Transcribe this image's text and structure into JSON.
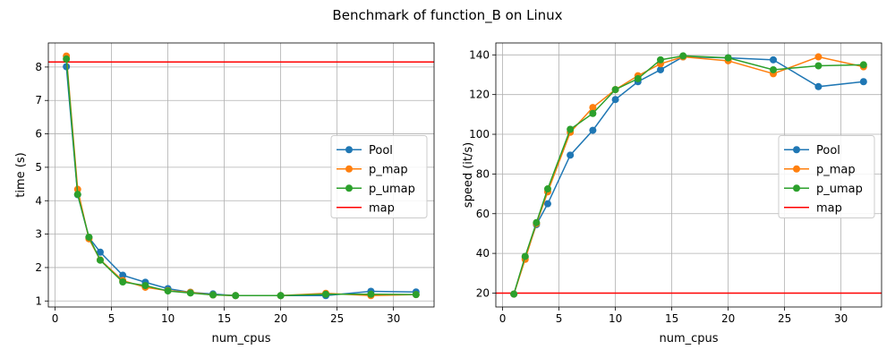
{
  "figure": {
    "title": "Benchmark of function_B on Linux"
  },
  "chart_data": [
    {
      "type": "line",
      "xlabel": "num_cpus",
      "ylabel": "time (s)",
      "xlim": [
        -0.6,
        33.6
      ],
      "ylim": [
        0.82,
        8.72
      ],
      "xticks": [
        0,
        5,
        10,
        15,
        20,
        25,
        30
      ],
      "yticks": [
        1,
        2,
        3,
        4,
        5,
        6,
        7,
        8
      ],
      "grid": true,
      "legend_placement": "center-right",
      "x": [
        1,
        2,
        3,
        4,
        6,
        8,
        10,
        12,
        14,
        16,
        20,
        24,
        28,
        32
      ],
      "series": [
        {
          "name": "Pool",
          "color": "#1f77b4",
          "marker": "circle",
          "values": [
            8.01,
            4.18,
            2.9,
            2.46,
            1.77,
            1.56,
            1.37,
            1.26,
            1.21,
            1.16,
            1.16,
            1.16,
            1.29,
            1.27
          ]
        },
        {
          "name": "p_map",
          "color": "#ff7f0e",
          "marker": "circle",
          "values": [
            8.33,
            4.34,
            2.86,
            2.23,
            1.61,
            1.41,
            1.31,
            1.26,
            1.18,
            1.16,
            1.16,
            1.23,
            1.16,
            1.19
          ]
        },
        {
          "name": "p_umap",
          "color": "#2ca02c",
          "marker": "circle",
          "values": [
            8.24,
            4.19,
            2.91,
            2.22,
            1.57,
            1.46,
            1.3,
            1.24,
            1.18,
            1.16,
            1.16,
            1.2,
            1.2,
            1.19
          ]
        }
      ],
      "hline": {
        "name": "map",
        "color": "#ff0000",
        "value": 8.15
      }
    },
    {
      "type": "line",
      "xlabel": "num_cpus",
      "ylabel": "speed (it/s)",
      "xlim": [
        -0.6,
        33.6
      ],
      "ylim": [
        13.0,
        146.0
      ],
      "xticks": [
        0,
        5,
        10,
        15,
        20,
        25,
        30
      ],
      "yticks": [
        20,
        40,
        60,
        80,
        100,
        120,
        140
      ],
      "grid": true,
      "legend_placement": "center-right",
      "x": [
        1,
        2,
        3,
        4,
        6,
        8,
        10,
        12,
        14,
        16,
        20,
        24,
        28,
        32
      ],
      "series": [
        {
          "name": "Pool",
          "color": "#1f77b4",
          "marker": "circle",
          "values": [
            19.5,
            38,
            54.5,
            65,
            89.5,
            102,
            117.5,
            126.5,
            132.5,
            139,
            138.5,
            137.5,
            124,
            126.5
          ]
        },
        {
          "name": "p_map",
          "color": "#ff7f0e",
          "marker": "circle",
          "values": [
            19.5,
            37,
            55,
            71,
            101,
            113.5,
            122.5,
            129.5,
            135.5,
            139,
            137,
            130.5,
            139,
            134
          ]
        },
        {
          "name": "p_umap",
          "color": "#2ca02c",
          "marker": "circle",
          "values": [
            19.5,
            38.5,
            55.5,
            72.5,
            102.5,
            110.5,
            122.5,
            128,
            137.5,
            139.5,
            138.5,
            132.5,
            134.5,
            135
          ]
        }
      ],
      "hline": {
        "name": "map",
        "color": "#ff0000",
        "value": 20
      }
    }
  ]
}
